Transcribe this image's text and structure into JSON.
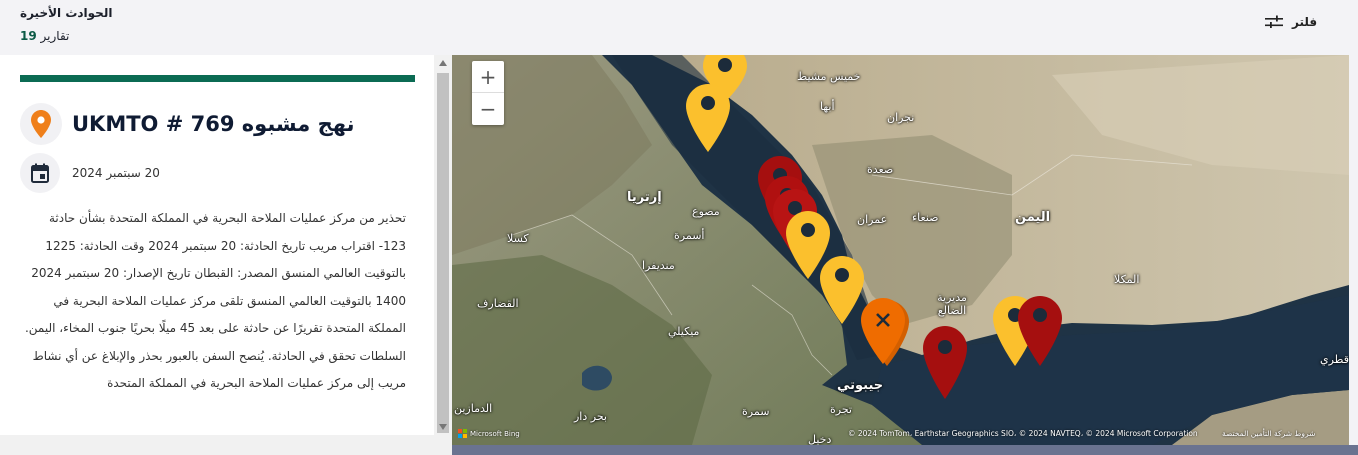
{
  "header": {
    "title": "الحوادث الأخيرة",
    "reports_label": "تقارير",
    "reports_count": "19",
    "filter_label": "فلتر"
  },
  "incident": {
    "title": "UKMTO # 769 نهج مشبوه",
    "date": "20 سبتمبر 2024",
    "description": "تحذير من مركز عمليات الملاحة البحرية في المملكة المتحدة بشأن حادثة 123- اقتراب مريب تاريخ الحادثة: 20 سبتمبر 2024 وقت الحادثة: 1225 بالتوقيت العالمي المنسق المصدر: القبطان تاريخ الإصدار: 20 سبتمبر 2024 1400 بالتوقيت العالمي المنسق تلقى مركز عمليات الملاحة البحرية في المملكة المتحدة تقريرًا عن حادثة على بعد 45 ميلًا بحريًا جنوب المخاء، اليمن. السلطات تحقق في الحادثة. يُنصح السفن بالعبور بحذر والإبلاغ عن أي نشاط مريب إلى مركز عمليات الملاحة البحرية في المملكة المتحدة",
    "icon": "map-pin-icon",
    "date_icon": "calendar-icon"
  },
  "map": {
    "zoom_in": "+",
    "zoom_out": "−",
    "labels": [
      {
        "id": "khamis",
        "text": "خميس مشيط"
      },
      {
        "id": "abha",
        "text": "أبها"
      },
      {
        "id": "najran",
        "text": "نجران"
      },
      {
        "id": "saada",
        "text": "صعدة"
      },
      {
        "id": "eritrea",
        "text": "إرتريا"
      },
      {
        "id": "massawa",
        "text": "مصوع"
      },
      {
        "id": "asmara",
        "text": "أسمرة"
      },
      {
        "id": "sanaa",
        "text": "صنعاء"
      },
      {
        "id": "amran",
        "text": "عمران"
      },
      {
        "id": "yemen",
        "text": "اليمن"
      },
      {
        "id": "kassala",
        "text": "كسلا"
      },
      {
        "id": "mendefera",
        "text": "منديفرا"
      },
      {
        "id": "mukalla",
        "text": "المكلا"
      },
      {
        "id": "gedaref",
        "text": "القضارف"
      },
      {
        "id": "mekele",
        "text": "ميكيلي"
      },
      {
        "id": "dhale",
        "text": "مديرية الضالع"
      },
      {
        "id": "djibouti",
        "text": "جيبوتي"
      },
      {
        "id": "qatari",
        "text": "قطري"
      },
      {
        "id": "damazin",
        "text": "الدمازين"
      },
      {
        "id": "bahirdar",
        "text": "بحر دار"
      },
      {
        "id": "semera",
        "text": "سمرة"
      },
      {
        "id": "tadjoura",
        "text": "تجرة"
      },
      {
        "id": "dikhil",
        "text": "دخيل"
      }
    ],
    "bing_label": "Microsoft Bing",
    "attribution": "© 2024 TomTom، Earthstar Geographics SIO، © 2024 NAVTEQ، © 2024 Microsoft Corporation",
    "terms": "شروط شركة التأمين المختصة",
    "pin_colors": {
      "yellow": "#fbc02d",
      "red": "#b01010",
      "orange": "#ef6c00"
    }
  }
}
